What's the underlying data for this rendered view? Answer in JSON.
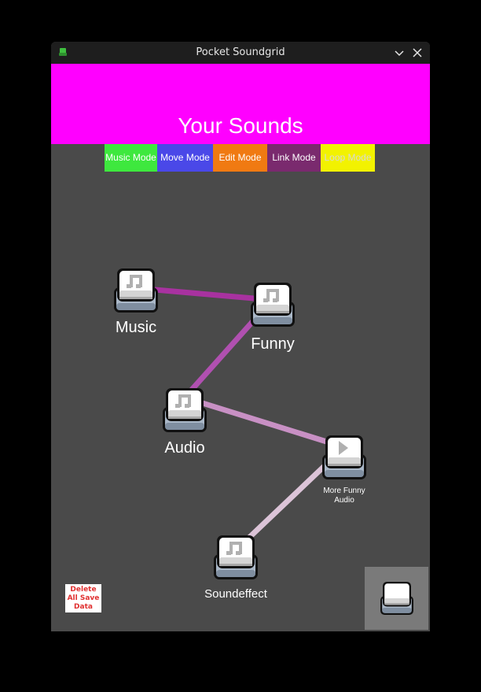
{
  "window": {
    "title": "Pocket Soundgrid"
  },
  "header": {
    "heading": "Your Sounds",
    "background": "#ff00ff"
  },
  "modes": [
    {
      "label": "Music Mode",
      "color": "#3ee83e"
    },
    {
      "label": "Move Mode",
      "color": "#4a48e8"
    },
    {
      "label": "Edit Mode",
      "color": "#f07a12"
    },
    {
      "label": "Link Mode",
      "color": "#7a2a6e"
    },
    {
      "label": "Loop Mode",
      "color": "#f2f200"
    }
  ],
  "sounds": [
    {
      "label": "Music",
      "icon": "music-note-icon"
    },
    {
      "label": "Funny",
      "icon": "music-note-icon"
    },
    {
      "label": "Audio",
      "icon": "music-note-icon"
    },
    {
      "label": "More Funny Audio",
      "icon": "play-icon"
    },
    {
      "label": "Soundeffect",
      "icon": "music-note-icon"
    }
  ],
  "links": [
    {
      "from": "Music",
      "to": "Funny",
      "color": "#a832a0"
    },
    {
      "from": "Funny",
      "to": "Audio",
      "color": "#b050b0"
    },
    {
      "from": "Audio",
      "to": "More Funny Audio",
      "color": "#c890c4"
    },
    {
      "from": "More Funny Audio",
      "to": "Soundeffect",
      "color": "#dcc4d8"
    }
  ],
  "footer": {
    "delete_label": "Delete All Save Data",
    "new_sound_icon": "blank-key-icon"
  }
}
